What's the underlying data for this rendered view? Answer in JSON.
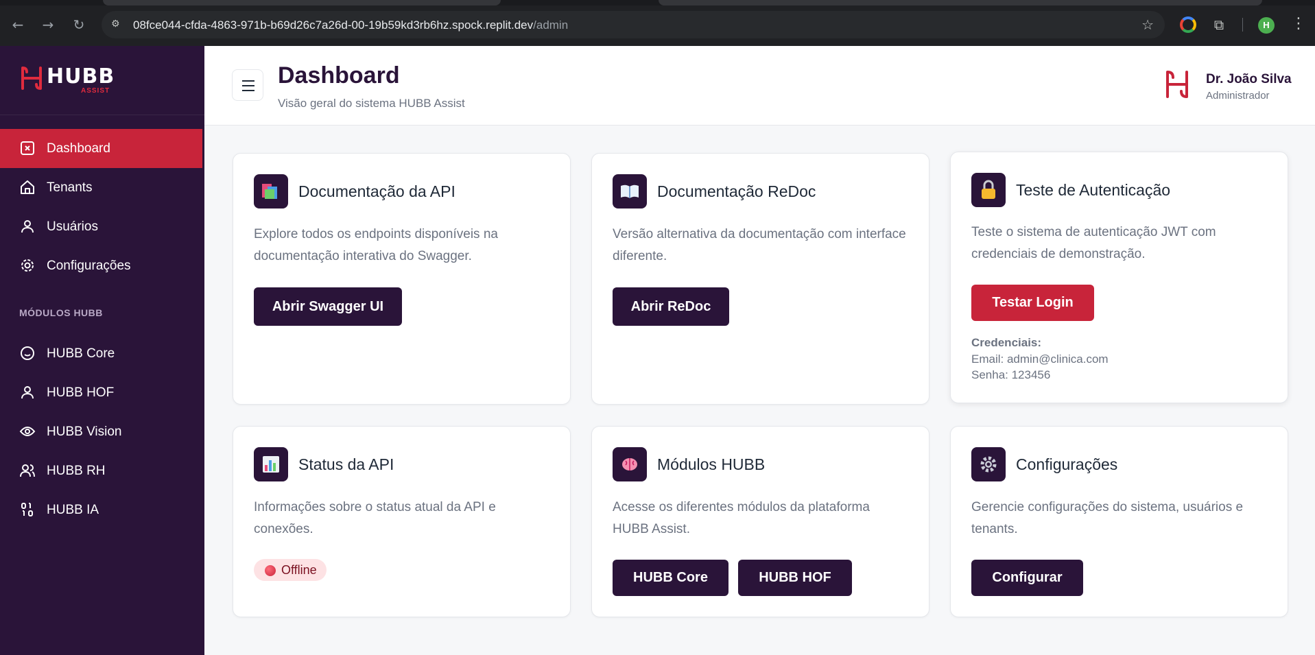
{
  "browser": {
    "url_host": "08fce044-cfda-4863-971b-b69d26c7a26d-00-19b59kd3rb6hz.spock.replit.dev",
    "url_path": "/admin",
    "profile_initial": "H"
  },
  "sidebar": {
    "brand": {
      "name": "HUBB",
      "tagline": "ASSIST"
    },
    "items": [
      {
        "label": "Dashboard",
        "icon": "dashboard-icon",
        "active": true
      },
      {
        "label": "Tenants",
        "icon": "home-icon"
      },
      {
        "label": "Usuários",
        "icon": "user-icon"
      },
      {
        "label": "Configurações",
        "icon": "gear-icon"
      }
    ],
    "section_title": "MÓDULOS HUBB",
    "modules": [
      {
        "label": "HUBB Core",
        "icon": "smile-icon"
      },
      {
        "label": "HUBB HOF",
        "icon": "user-icon"
      },
      {
        "label": "HUBB Vision",
        "icon": "eye-icon"
      },
      {
        "label": "HUBB RH",
        "icon": "users-icon"
      },
      {
        "label": "HUBB IA",
        "icon": "binary-icon"
      }
    ]
  },
  "header": {
    "title": "Dashboard",
    "subtitle": "Visão geral do sistema HUBB Assist",
    "user_name": "Dr. João Silva",
    "user_role": "Administrador"
  },
  "cards": {
    "api_docs": {
      "icon": "books-icon",
      "title": "Documentação da API",
      "description": "Explore todos os endpoints disponíveis na documentação interativa do Swagger.",
      "button": "Abrir Swagger UI"
    },
    "redoc": {
      "icon": "open-book-icon",
      "title": "Documentação ReDoc",
      "description": "Versão alternativa da documentação com interface diferente.",
      "button": "Abrir ReDoc"
    },
    "auth": {
      "icon": "lock-icon",
      "title": "Teste de Autenticação",
      "description": "Teste o sistema de autenticação JWT com credenciais de demonstração.",
      "button": "Testar Login",
      "creds_label": "Credenciais:",
      "email_line": "Email: admin@clinica.com",
      "password_line": "Senha: 123456"
    },
    "status": {
      "icon": "bar-chart-icon",
      "title": "Status da API",
      "description": "Informações sobre o status atual da API e conexões.",
      "badge": "Offline"
    },
    "modules": {
      "icon": "brain-icon",
      "title": "Módulos HUBB",
      "description": "Acesse os diferentes módulos da plataforma HUBB Assist.",
      "button_core": "HUBB Core",
      "button_hof": "HUBB HOF"
    },
    "settings": {
      "icon": "gear-icon",
      "title": "Configurações",
      "description": "Gerencie configurações do sistema, usuários e tenants.",
      "button": "Configurar"
    }
  },
  "colors": {
    "sidebar_bg": "#2a1439",
    "accent_red": "#c8243a",
    "primary_dark": "#2a1439"
  }
}
